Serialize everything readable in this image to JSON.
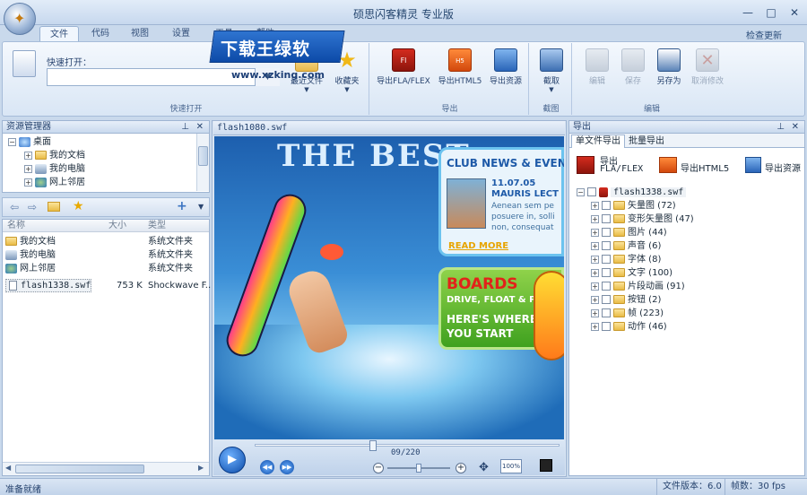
{
  "window": {
    "title": "硕思闪客精灵 专业版",
    "minimize": "—",
    "maximize": "□",
    "close": "✕"
  },
  "ribbon": {
    "tabs": [
      "文件",
      "代码",
      "视图",
      "设置",
      "工具",
      "帮助"
    ],
    "active_tab": "文件",
    "update_link": "检查更新",
    "groups": {
      "quick_open": {
        "label": "快速打开",
        "field_label": "快速打开：",
        "input_value": "",
        "btn_recent": "最近文件",
        "btn_favorites": "收藏夹"
      },
      "export": {
        "label": "导出",
        "btn_fla": "导出FLA/FLEX",
        "btn_html5": "导出HTML5",
        "btn_resources": "导出资源"
      },
      "capture": {
        "label": "截图",
        "btn_capture": "截取"
      },
      "edit": {
        "label": "编辑",
        "btn_edit": "编辑",
        "btn_save": "保存",
        "btn_save_as": "另存为",
        "btn_cancel": "取消修改"
      }
    }
  },
  "watermark": {
    "text": "下载王绿软",
    "url": "www.xzking.com"
  },
  "explorer": {
    "title": "资源管理器",
    "tree": [
      {
        "label": "桌面",
        "level": 0,
        "toggle": "−"
      },
      {
        "label": "我的文档",
        "level": 1,
        "toggle": "+"
      },
      {
        "label": "我的电脑",
        "level": 1,
        "toggle": "+"
      },
      {
        "label": "网上邻居",
        "level": 1,
        "toggle": "+"
      }
    ],
    "columns": {
      "name": "名称",
      "size": "大小",
      "type": "类型"
    },
    "files": [
      {
        "name": "我的文档",
        "size": "",
        "type": "系统文件夹"
      },
      {
        "name": "我的电脑",
        "size": "",
        "type": "系统文件夹"
      },
      {
        "name": "网上邻居",
        "size": "",
        "type": "系统文件夹"
      },
      {
        "name": "flash1338.swf",
        "size": "753 K",
        "type": "Shockwave F..."
      }
    ]
  },
  "preview": {
    "tab": "flash1080.swf",
    "frame_counter": "09/220",
    "zoom_label": "100%",
    "banner": {
      "headline": "THE BEST",
      "club_title": "CLUB NEWS & EVENTS",
      "date": "11.07.05",
      "event": "MAURIS LECT",
      "body1": "Aenean sem pe",
      "body2": "posuere in, solli",
      "body3": "non, consequat",
      "read_more": "READ MORE",
      "boards": "BOARDS",
      "boards_sub": "DRIVE, FLOAT & PRO",
      "start1": "HERE'S WHERE",
      "start2": "YOU START"
    }
  },
  "export_panel": {
    "title": "导出",
    "tab_single": "单文件导出",
    "tab_batch": "批量导出",
    "btn_fla": "导出\nFLA/FLEX",
    "btn_fla_l1": "导出",
    "btn_fla_l2": "FLA/FLEX",
    "btn_html5": "导出HTML5",
    "btn_resources": "导出资源",
    "root": "flash1338.swf",
    "items": [
      "矢量图 (72)",
      "变形矢量图 (47)",
      "图片 (44)",
      "声音 (6)",
      "字体 (8)",
      "文字 (100)",
      "片段动画 (91)",
      "按钮 (2)",
      "帧 (223)",
      "动作 (46)"
    ]
  },
  "status": {
    "left": "准备就绪",
    "version": "文件版本：6.0",
    "fps": "帧数：30 fps"
  },
  "colors": {
    "accent": "#1f4e8c",
    "panel_bg": "#c9d9ec",
    "ribbon_bg": "#e8f0fa"
  }
}
